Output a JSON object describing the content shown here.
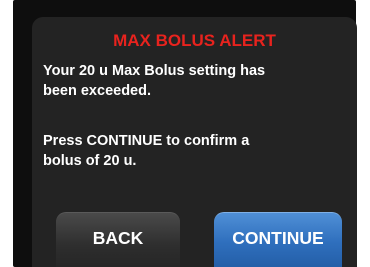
{
  "alert": {
    "title": "MAX BOLUS ALERT",
    "message_lines": [
      "Your 20 u Max Bolus setting has",
      "been exceeded.",
      "Press CONTINUE to confirm a",
      "bolus of 20 u."
    ]
  },
  "buttons": {
    "back_label": "BACK",
    "continue_label": "CONTINUE"
  },
  "colors": {
    "title": "#e8231e",
    "screen_bg": "#232323",
    "continue_button": "#2f6fbd",
    "back_button": "#3a3a3a"
  }
}
